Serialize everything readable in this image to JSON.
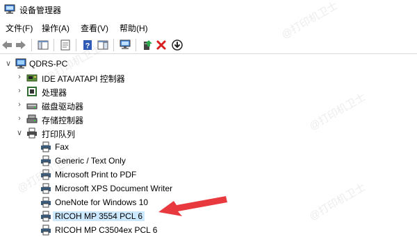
{
  "window": {
    "title": "设备管理器"
  },
  "menu": [
    {
      "label": "文件(F)"
    },
    {
      "label": "操作(A)"
    },
    {
      "label": "查看(V)"
    },
    {
      "label": "帮助(H)"
    }
  ],
  "toolbar": {
    "buttons": [
      {
        "icon": "back-arrow-icon"
      },
      {
        "icon": "forward-arrow-icon"
      },
      {
        "icon": "show-hide-console-tree-icon"
      },
      {
        "icon": "properties-icon"
      },
      {
        "icon": "help-icon"
      },
      {
        "icon": "action-pane-icon"
      },
      {
        "icon": "scan-hardware-changes-icon"
      },
      {
        "icon": "update-driver-icon"
      },
      {
        "icon": "uninstall-device-icon"
      },
      {
        "icon": "disable-device-icon"
      }
    ]
  },
  "tree": {
    "root": {
      "label": "QDRS-PC",
      "expanded": true
    },
    "categories": [
      {
        "label": "IDE ATA/ATAPI 控制器",
        "expanded": false,
        "icon": "ide-controller-icon"
      },
      {
        "label": "处理器",
        "expanded": false,
        "icon": "processor-icon"
      },
      {
        "label": "磁盘驱动器",
        "expanded": false,
        "icon": "disk-drive-icon"
      },
      {
        "label": "存储控制器",
        "expanded": false,
        "icon": "storage-controller-icon"
      },
      {
        "label": "打印队列",
        "expanded": true,
        "icon": "printer-icon"
      }
    ],
    "printers": [
      {
        "label": "Fax",
        "selected": false
      },
      {
        "label": "Generic / Text Only",
        "selected": false
      },
      {
        "label": "Microsoft Print to PDF",
        "selected": false
      },
      {
        "label": "Microsoft XPS Document Writer",
        "selected": false
      },
      {
        "label": "OneNote for Windows 10",
        "selected": false
      },
      {
        "label": "RICOH MP 3554 PCL 6",
        "selected": true
      },
      {
        "label": "RICOH MP C3504ex PCL 6",
        "selected": false
      }
    ]
  },
  "annotation": {
    "color": "#e8393f"
  },
  "watermark": {
    "text": "@打印机卫士"
  }
}
